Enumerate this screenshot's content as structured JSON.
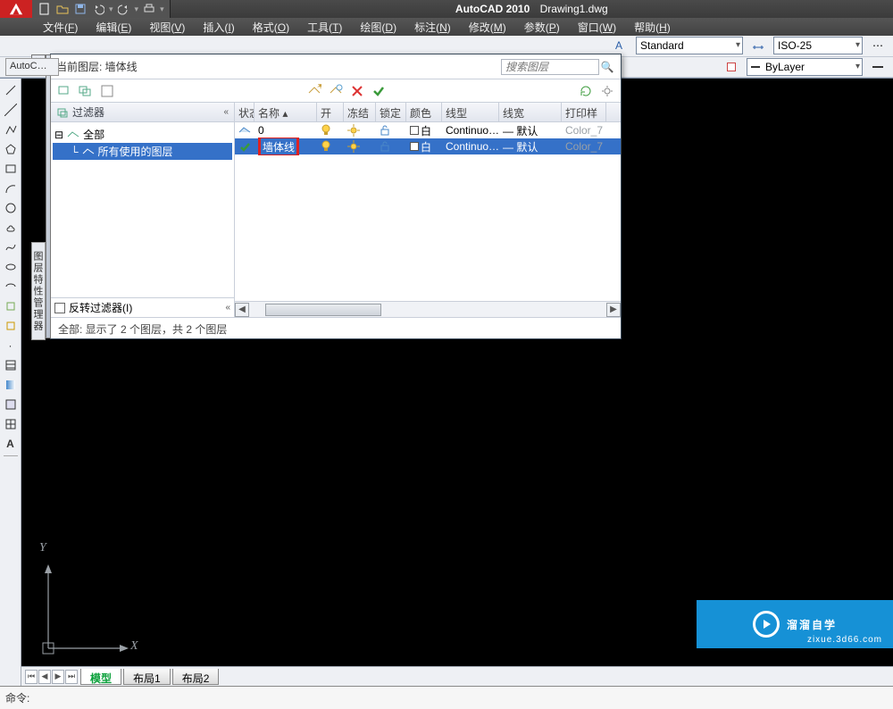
{
  "app": {
    "name": "AutoCAD 2010",
    "doc": "Drawing1.dwg"
  },
  "menus": [
    {
      "label": "文件",
      "acc": "F"
    },
    {
      "label": "编辑",
      "acc": "E"
    },
    {
      "label": "视图",
      "acc": "V"
    },
    {
      "label": "插入",
      "acc": "I"
    },
    {
      "label": "格式",
      "acc": "O"
    },
    {
      "label": "工具",
      "acc": "T"
    },
    {
      "label": "绘图",
      "acc": "D"
    },
    {
      "label": "标注",
      "acc": "N"
    },
    {
      "label": "修改",
      "acc": "M"
    },
    {
      "label": "参数",
      "acc": "P"
    },
    {
      "label": "窗口",
      "acc": "W"
    },
    {
      "label": "帮助",
      "acc": "H"
    }
  ],
  "styleCombos": {
    "textStyle": "Standard",
    "dimStyle": "ISO-25",
    "byLayer": "ByLayer"
  },
  "docTab": "AutoC…",
  "dialog": {
    "currentLabel": "当前图层: 墙体线",
    "searchPlaceholder": "搜索图层",
    "sideLabel": "图层特性管理器",
    "filterHeader": "过滤器",
    "treeAll": "全部",
    "treeUsed": "所有使用的图层",
    "invertFilter": "反转过滤器(I)",
    "columns": [
      "状态",
      "名称",
      "开",
      "冻结",
      "锁定",
      "颜色",
      "线型",
      "线宽",
      "打印样"
    ],
    "layers": [
      {
        "state": "cur",
        "name": "0",
        "on": true,
        "freeze": false,
        "lock": false,
        "color": "白",
        "linetype": "Continuo…",
        "lineweight": "— 默认",
        "plot": "Color_7",
        "sel": false
      },
      {
        "state": "ok",
        "name": "墙体线",
        "on": true,
        "freeze": false,
        "lock": false,
        "color": "白",
        "linetype": "Continuo…",
        "lineweight": "— 默认",
        "plot": "Color_7",
        "sel": true
      }
    ],
    "status": "全部: 显示了 2 个图层，共 2 个图层"
  },
  "tabs": {
    "model": "模型",
    "layout1": "布局1",
    "layout2": "布局2"
  },
  "cmd": "命令:",
  "axes": {
    "x": "X",
    "y": "Y"
  },
  "watermark": {
    "text": "溜溜自学",
    "sub": "zixue.3d66.com"
  }
}
